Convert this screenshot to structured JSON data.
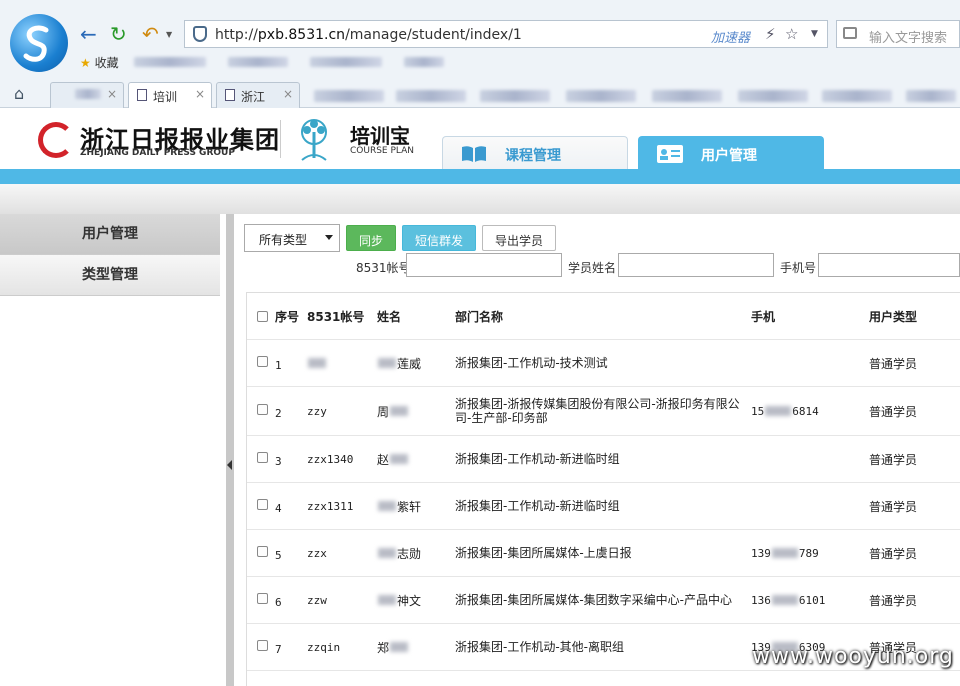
{
  "browser": {
    "url_prefix": "http://",
    "url_host": "pxb.8531.cn",
    "url_path": "/manage/student/index/1",
    "accelerator": "加速器",
    "search_placeholder": "输入文字搜索",
    "favorites_label": "收藏",
    "tabs": [
      {
        "label": "培训"
      },
      {
        "label": "浙江"
      }
    ]
  },
  "brand": {
    "name": "浙江日报报业集团",
    "name_en": "ZHEJIANG DAILY PRESS GROUP",
    "product": "培训宝",
    "product_en": "COURSE PLAN"
  },
  "nav": {
    "course": "课程管理",
    "user": "用户管理"
  },
  "sidebar": {
    "items": [
      {
        "label": "用户管理"
      },
      {
        "label": "类型管理"
      }
    ]
  },
  "toolbar": {
    "type_select": "所有类型",
    "sync": "同步",
    "sms": "短信群发",
    "export": "导出学员"
  },
  "filters": {
    "account_label": "8531帐号",
    "name_label": "学员姓名",
    "phone_label": "手机号"
  },
  "table": {
    "headers": {
      "no": "序号",
      "account": "8531帐号",
      "name": "姓名",
      "dept": "部门名称",
      "phone": "手机",
      "type": "用户类型"
    },
    "rows": [
      {
        "no": "1",
        "account": "",
        "name_visible": "莲威",
        "name_prefix": "",
        "dept": "浙报集团-工作机动-技术测试",
        "dept2": "",
        "phone_a": "",
        "phone_b": "",
        "type": "普通学员"
      },
      {
        "no": "2",
        "account": "zzy",
        "name_visible": "",
        "name_prefix": "周",
        "dept": "浙报集团-浙报传媒集团股份有限公司-浙报印务有限公",
        "dept2": "司-生产部-印务部",
        "phone_a": "15",
        "phone_b": "6814",
        "type": "普通学员"
      },
      {
        "no": "3",
        "account": "zzx1340",
        "name_visible": "",
        "name_prefix": "赵",
        "dept": "浙报集团-工作机动-新进临时组",
        "dept2": "",
        "phone_a": "",
        "phone_b": "",
        "type": "普通学员"
      },
      {
        "no": "4",
        "account": "zzx1311",
        "name_visible": "紫轩",
        "name_prefix": "",
        "dept": "浙报集团-工作机动-新进临时组",
        "dept2": "",
        "phone_a": "",
        "phone_b": "",
        "type": "普通学员"
      },
      {
        "no": "5",
        "account": "zzx",
        "name_visible": "志勋",
        "name_prefix": "",
        "dept": "浙报集团-集团所属媒体-上虞日报",
        "dept2": "",
        "phone_a": "139",
        "phone_b": "789",
        "type": "普通学员"
      },
      {
        "no": "6",
        "account": "zzw",
        "name_visible": "神文",
        "name_prefix": "",
        "dept": "浙报集团-集团所属媒体-集团数字采编中心-产品中心",
        "dept2": "",
        "phone_a": "136",
        "phone_b": "6101",
        "type": "普通学员"
      },
      {
        "no": "7",
        "account": "zzqin",
        "name_visible": "",
        "name_prefix": "郑",
        "dept": "浙报集团-工作机动-其他-离职组",
        "dept2": "",
        "phone_a": "139",
        "phone_b": "6309",
        "type": "普通学员"
      }
    ]
  },
  "watermark": "www.wooyun.org",
  "colors": {
    "accent_blue": "#4fb8e6",
    "green": "#5cb85c",
    "light_blue": "#5bc0de"
  }
}
